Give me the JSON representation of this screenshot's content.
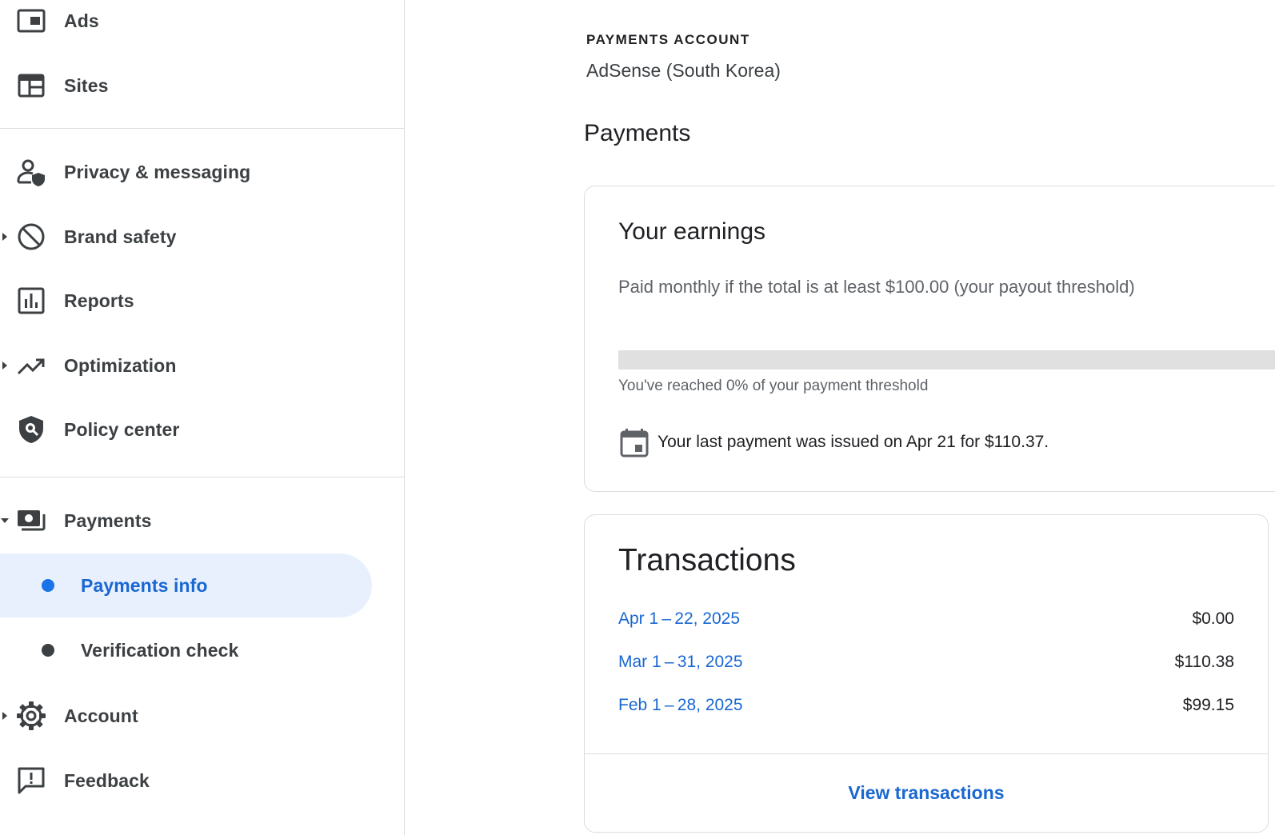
{
  "sidebar": {
    "items": [
      {
        "label": "Ads",
        "icon": "ads-icon"
      },
      {
        "label": "Sites",
        "icon": "sites-icon"
      },
      {
        "label": "Privacy & messaging",
        "icon": "privacy-icon"
      },
      {
        "label": "Brand safety",
        "icon": "block-icon"
      },
      {
        "label": "Reports",
        "icon": "bar-chart-icon"
      },
      {
        "label": "Optimization",
        "icon": "trending-up-icon"
      },
      {
        "label": "Policy center",
        "icon": "shield-search-icon"
      },
      {
        "label": "Payments",
        "icon": "payments-icon"
      },
      {
        "label": "Payments info"
      },
      {
        "label": "Verification check"
      },
      {
        "label": "Account",
        "icon": "gear-icon"
      },
      {
        "label": "Feedback",
        "icon": "feedback-icon"
      }
    ]
  },
  "main": {
    "eyebrow": "PAYMENTS ACCOUNT",
    "account_name": "AdSense (South Korea)",
    "section_title": "Payments",
    "earnings": {
      "title": "Your earnings",
      "subtitle": "Paid monthly if the total is at least $100.00 (your payout threshold)",
      "progress_percent": 0,
      "progress_caption": "You've reached 0% of your payment threshold",
      "last_payment": "Your last payment was issued on Apr 21 for $110.37."
    },
    "transactions": {
      "title": "Transactions",
      "rows": [
        {
          "period": "Apr 1 – 22, 2025",
          "amount": "$0.00"
        },
        {
          "period": "Mar 1 – 31, 2025",
          "amount": "$110.38"
        },
        {
          "period": "Feb 1 – 28, 2025",
          "amount": "$99.15"
        }
      ],
      "view_label": "View transactions"
    }
  },
  "colors": {
    "accent": "#1a73e8",
    "link": "#1967d2",
    "active_bg": "#e8f0fe",
    "text": "#3c4043",
    "border": "#dadce0",
    "track": "#e0e0e0"
  }
}
